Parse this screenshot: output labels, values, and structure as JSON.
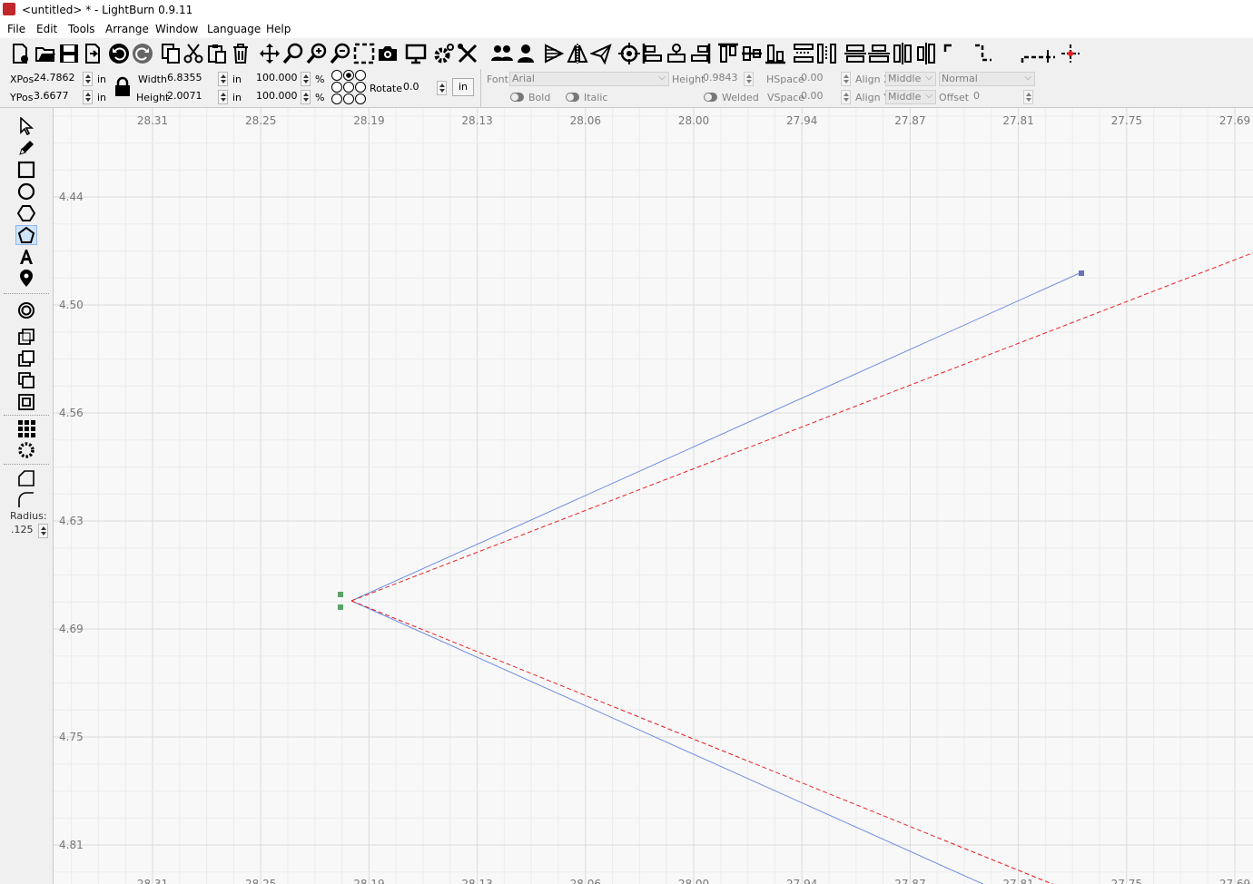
{
  "window": {
    "title": "<untitled> * - LightBurn 0.9.11"
  },
  "menu": [
    "File",
    "Edit",
    "Tools",
    "Arrange",
    "Window",
    "Language",
    "Help"
  ],
  "toolbar_icons": [
    "new-file",
    "open-file",
    "save-file",
    "import",
    "undo",
    "redo",
    "copy",
    "cut",
    "paste",
    "delete",
    "move",
    "zoom",
    "zoom-in",
    "zoom-out",
    "frame-select",
    "camera",
    "monitor",
    "settings",
    "tools",
    "group",
    "ungroup",
    "mirror-h",
    "mirror-v",
    "send-to-laser",
    "center",
    "align-left",
    "align-center-v",
    "align-right",
    "align-top",
    "align-center-h",
    "align-bottom",
    "distribute-h",
    "distribute-v",
    "space-h",
    "space-v",
    "path-step-1",
    "path-step-2",
    "path-step-3",
    "origin"
  ],
  "props": {
    "xpos_label": "XPos",
    "xpos": "24.7862",
    "xpos_unit": "in",
    "ypos_label": "YPos",
    "ypos": "3.6677",
    "ypos_unit": "in",
    "width_label": "Width",
    "width": "6.8355",
    "width_unit": "in",
    "height_label": "Height",
    "height": "2.0071",
    "height_unit": "in",
    "scale_x": "100.000",
    "scale_y": "100.000",
    "pct": "%",
    "rotate_label": "Rotate",
    "rotate": "0.0",
    "unit_button": "in",
    "font_label": "Font",
    "font": "Arial",
    "text_height_label": "Height",
    "text_height": "0.9843",
    "hspace_label": "HSpace",
    "hspace": "0.00",
    "vspace_label": "VSpace",
    "vspace": "0.00",
    "alignx_label": "Align X",
    "alignx": "Middle",
    "aligny_label": "Align Y",
    "aligny": "Middle",
    "style": "Normal",
    "offset_label": "Offset",
    "offset": "0",
    "bold_label": "Bold",
    "italic_label": "Italic",
    "welded_label": "Welded"
  },
  "sidebar": {
    "radius_label": "Radius:",
    "radius_value": ".125"
  },
  "ruler": {
    "x_ticks": [
      "28.31",
      "28.25",
      "28.19",
      "28.13",
      "28.06",
      "28.00",
      "27.94",
      "27.87",
      "27.81",
      "27.75",
      "27.69"
    ],
    "y_ticks": [
      "4.44",
      "4.50",
      "4.56",
      "4.63",
      "4.69",
      "4.75",
      "4.81"
    ]
  },
  "colors": {
    "path_blue": "#6f8ee0",
    "path_red": "#e82020",
    "node_green": "#5aa36a",
    "node_blue": "#6a72b8"
  }
}
